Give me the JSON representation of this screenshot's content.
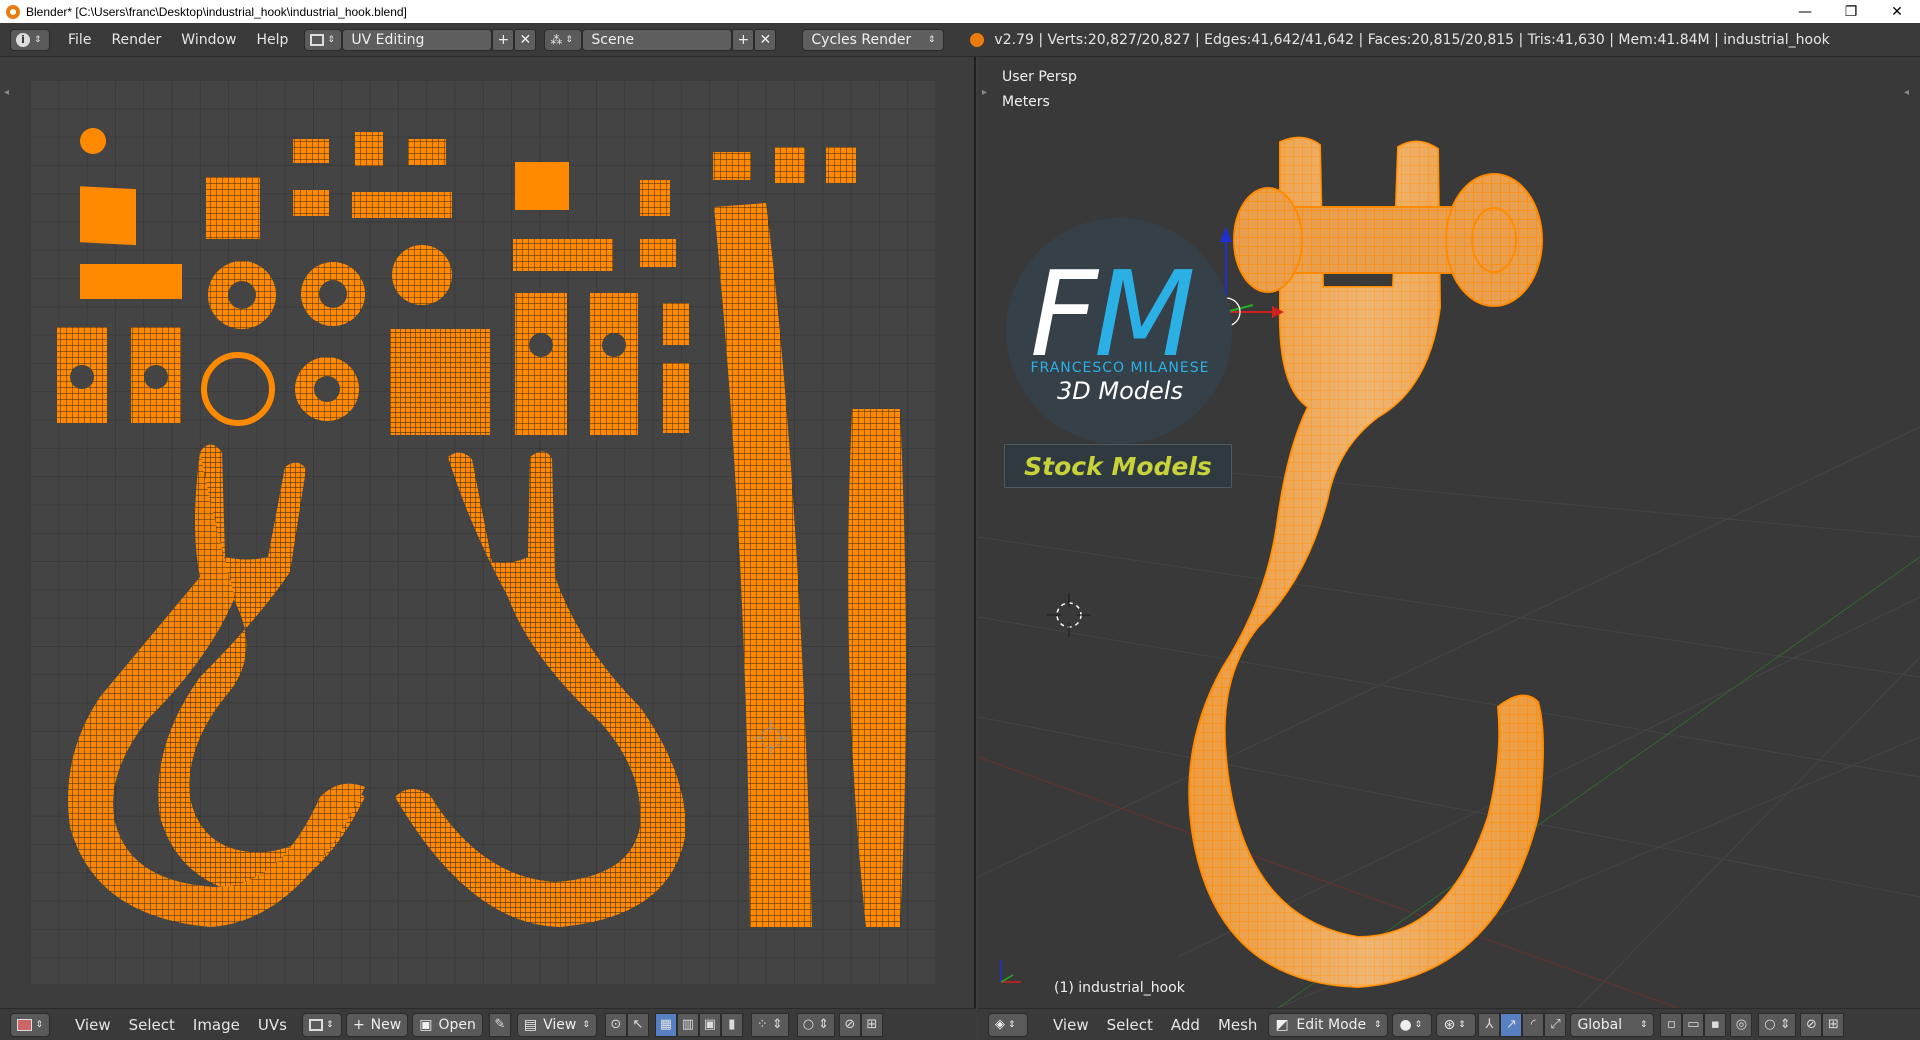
{
  "window": {
    "title": "Blender* [C:\\Users\\franc\\Desktop\\industrial_hook\\industrial_hook.blend]",
    "minimize": "—",
    "restore": "❐",
    "close": "✕"
  },
  "info_header": {
    "menus": [
      "File",
      "Render",
      "Window",
      "Help"
    ],
    "screen_layout": "UV Editing",
    "scene": "Scene",
    "render_engine": "Cycles Render",
    "stats": "v2.79 | Verts:20,827/20,827 | Edges:41,642/41,642 | Faces:20,815/20,815 | Tris:41,630 | Mem:41.84M | industrial_hook"
  },
  "viewport": {
    "view_label": "User Persp",
    "units_label": "Meters",
    "object_label": "(1) industrial_hook"
  },
  "logo": {
    "f": "F",
    "m": "M",
    "name": "FRANCESCO MILANESE",
    "tagline": "3D Models",
    "banner": "Stock Models"
  },
  "uv_footer": {
    "menus": [
      "View",
      "Select",
      "Image",
      "UVs"
    ],
    "new_label": "New",
    "open_label": "Open",
    "view_label": "View"
  },
  "view3d_footer": {
    "menus": [
      "View",
      "Select",
      "Add",
      "Mesh"
    ],
    "mode": "Edit Mode",
    "orientation": "Global"
  },
  "colors": {
    "mesh": "#ff8a00",
    "background": "#3d3d3d"
  }
}
